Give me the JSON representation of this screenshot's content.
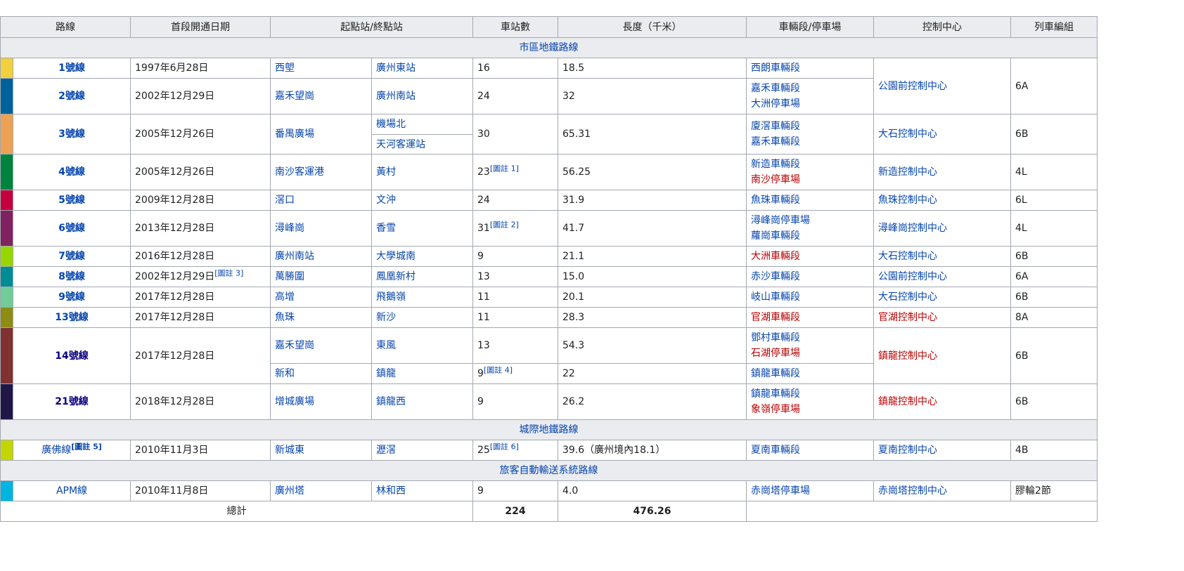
{
  "headers": [
    "路線",
    "首段開通日期",
    "起點站/終點站",
    "車站數",
    "長度（千米）",
    "車輛段/停車場",
    "控制中心",
    "列車編組"
  ],
  "sections": {
    "urban": "市區地鐵路線",
    "intercity": "城際地鐵路線",
    "apm": "旅客自動輸送系統路線"
  },
  "rows": [
    {
      "line": "1號線",
      "color": "#F3D03E",
      "date": "1997年6月28日",
      "start": "西塱",
      "end": "廣州東站",
      "stations": "16",
      "length": "18.5",
      "depots": [
        "西朗車輛段"
      ],
      "control": "公園前控制中心",
      "formation": "6A"
    },
    {
      "line": "2號線",
      "color": "#00629B",
      "date": "2002年12月29日",
      "start": "嘉禾望崗",
      "end": "廣州南站",
      "stations": "24",
      "length": "32",
      "depots": [
        "嘉禾車輛段",
        "大洲停車場"
      ]
    },
    {
      "line": "3號線",
      "color": "#ECA154",
      "date": "2005年12月26日",
      "start": "番禺廣場",
      "end": "機場北",
      "end2": "天河客運站",
      "stations": "30",
      "length": "65.31",
      "depots": [
        "廈滘車輛段",
        "嘉禾車輛段"
      ],
      "control": "大石控制中心",
      "formation": "6B"
    },
    {
      "line": "4號線",
      "color": "#00843D",
      "date": "2005年12月26日",
      "start": "南沙客運港",
      "end": "黃村",
      "stations": "23",
      "stations_ref": "[圖註 1]",
      "length": "56.25",
      "depots": [
        "新造車輛段",
        "南沙停車場"
      ],
      "control": "新造控制中心",
      "formation": "4L"
    },
    {
      "line": "5號線",
      "color": "#C5003E",
      "date": "2009年12月28日",
      "start": "滘口",
      "end": "文沖",
      "stations": "24",
      "length": "31.9",
      "depots": [
        "魚珠車輛段"
      ],
      "control": "魚珠控制中心",
      "formation": "6L"
    },
    {
      "line": "6號線",
      "color": "#80225F",
      "date": "2013年12月28日",
      "start": "潯峰崗",
      "end": "香雪",
      "stations": "31",
      "stations_ref": "[圖註 2]",
      "length": "41.7",
      "depots": [
        "潯峰崗停車場",
        "蘿崗車輛段"
      ],
      "control": "潯峰崗控制中心",
      "formation": "4L"
    },
    {
      "line": "7號線",
      "color": "#97D700",
      "date": "2016年12月28日",
      "start": "廣州南站",
      "end": "大學城南",
      "stations": "9",
      "length": "21.1",
      "depots": [
        "大洲車輛段"
      ],
      "control": "大石控制中心",
      "formation": "6B"
    },
    {
      "line": "8號線",
      "color": "#008C95",
      "date": "2002年12月29日",
      "date_ref": "[圖註 3]",
      "start": "萬勝圍",
      "end": "鳳凰新村",
      "stations": "13",
      "length": "15.0",
      "depots": [
        "赤沙車輛段"
      ],
      "control": "公園前控制中心",
      "formation": "6A"
    },
    {
      "line": "9號線",
      "color": "#71CC98",
      "date": "2017年12月28日",
      "start": "高增",
      "end": "飛鵝嶺",
      "stations": "11",
      "length": "20.1",
      "depots": [
        "岐山車輛段"
      ],
      "control": "大石控制中心",
      "formation": "6B"
    },
    {
      "line": "13號線",
      "color": "#8E8C13",
      "date": "2017年12月28日",
      "start": "魚珠",
      "end": "新沙",
      "stations": "11",
      "length": "28.3",
      "depots": [
        "官湖車輛段"
      ],
      "control": "官湖控制中心",
      "formation": "8A"
    },
    {
      "line": "14號線",
      "color": "#81312F",
      "date": "2017年12月28日",
      "start": "嘉禾望崗",
      "end": "東風",
      "stations": "13",
      "length": "54.3",
      "depots": [
        "鄧村車輛段",
        "石湖停車場"
      ],
      "control": "鎮龍控制中心",
      "formation": "6B",
      "sub": {
        "start": "新和",
        "end": "鎮龍",
        "stations": "9",
        "stations_ref": "[圖註 4]",
        "length": "22",
        "depots": [
          "鎮龍車輛段"
        ]
      }
    },
    {
      "line": "21號線",
      "color": "#201747",
      "date": "2018年12月28日",
      "start": "增城廣場",
      "end": "鎮龍西",
      "stations": "9",
      "length": "26.2",
      "depots": [
        "鎮龍車輛段",
        "象嶺停車場"
      ],
      "control": "鎮龍控制中心",
      "formation": "6B"
    }
  ],
  "intercity_row": {
    "line": "廣佛線",
    "line_ref": "[圖註 5]",
    "color": "#C4D600",
    "date": "2010年11月3日",
    "start": "新城東",
    "end": "瀝滘",
    "stations": "25",
    "stations_ref": "[圖註 6]",
    "length": "39.6（廣州境內18.1）",
    "depots": [
      "夏南車輛段"
    ],
    "control": "夏南控制中心",
    "formation": "4B"
  },
  "apm_row": {
    "line": "APM線",
    "color": "#00B5E2",
    "date": "2010年11月8日",
    "start": "廣州塔",
    "end": "林和西",
    "stations": "9",
    "length": "4.0",
    "depots": [
      "赤崗塔停車場"
    ],
    "control": "赤崗塔控制中心",
    "formation": "膠輪2節"
  },
  "total": {
    "label": "總計",
    "stations": "224",
    "length": "476.26"
  },
  "shared_control_12": {
    "control": "公園前控制中心",
    "formation": "6A"
  }
}
